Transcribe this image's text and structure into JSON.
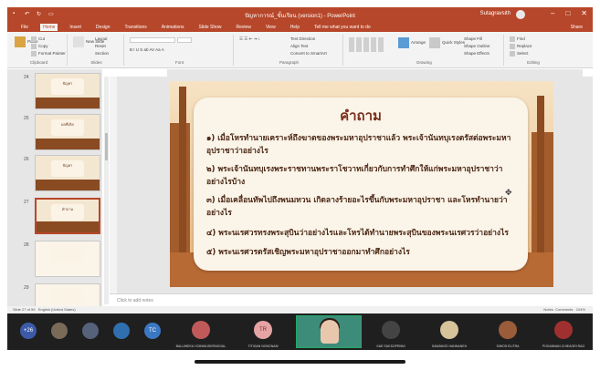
{
  "titlebar": {
    "document_title": "ปัญหาการณ์_ขั้นเรียน (version1) - PowerPoint",
    "user_name": "Sutagravsith",
    "minimize": "–",
    "restore": "□",
    "close": "✕"
  },
  "ribbon_tabs": [
    "File",
    "Home",
    "Insert",
    "Design",
    "Transitions",
    "Animations",
    "Slide Show",
    "Review",
    "View",
    "Help"
  ],
  "tell_me": "Tell me what you want to do",
  "share_label": "Share",
  "ribbon": {
    "clipboard": {
      "paste": "Paste",
      "cut": "Cut",
      "copy": "Copy",
      "format_painter": "Format Painter",
      "label": "Clipboard"
    },
    "slides": {
      "new_slide": "New Slide",
      "layout": "Layout",
      "reset": "Reset",
      "section": "Section",
      "label": "Slides"
    },
    "font": {
      "label": "Font"
    },
    "paragraph": {
      "text_direction": "Text Direction",
      "align_text": "Align Text",
      "convert_smartart": "Convert to SmartArt",
      "label": "Paragraph"
    },
    "drawing": {
      "arrange": "Arrange",
      "quick_styles": "Quick Styles",
      "shape_fill": "Shape Fill",
      "shape_outline": "Shape Outline",
      "shape_effects": "Shape Effects",
      "label": "Drawing"
    },
    "editing": {
      "find": "Find",
      "replace": "Replace",
      "select": "Select",
      "label": "Editing"
    }
  },
  "slides_panel": [
    {
      "number": "24",
      "title": "ปัญหา"
    },
    {
      "number": "25",
      "title": "ผลที่เกิด"
    },
    {
      "number": "26",
      "title": "ปัญหา"
    },
    {
      "number": "27",
      "title": "คำถาม",
      "selected": true
    },
    {
      "number": "28",
      "title": ""
    },
    {
      "number": "29",
      "title": ""
    }
  ],
  "slide": {
    "title": "คำถาม",
    "questions": [
      "๑) เมื่อโหรทำนายเคราะห์ถึงฆาตของพระมหาอุปราชาแล้ว พระเจ้านันทบุเรงตรัสต่อพระมหาอุปราชาว่าอย่างไร",
      "๒) พระเจ้านันทบุเรงพระราชทานพระราโชวาทเกี่ยวกับการทำศึกให้แก่พระมหาอุปราชาว่าอย่างไรบ้าง",
      "๓) เมื่อเคลื่อนทัพไปถึงพนมทวน เกิดลางร้ายอะไรขึ้นกับพระมหาอุปราชา และโหรทำนายว่าอย่างไร",
      "๔) พระนเรศวรทรงพระสุบินว่าอย่างไรและโหรได้ทำนายพระสุบินของพระนเรศวรว่าอย่างไร",
      "๕) พระนเรศวรตรัสเชิญพระมหาอุปราชาออกมาทำศึกอย่างไร"
    ]
  },
  "notes_placeholder": "Click to add notes",
  "status": {
    "slide_count": "Slide 27 of 59",
    "language": "English (United States)",
    "notes": "Notes",
    "comments": "Comments",
    "zoom": "104%"
  },
  "meeting": {
    "more_count": "+26",
    "participants": [
      {
        "name": "BALUWEKU HOINWUSKRNOGAL",
        "color": "#c05a5a"
      },
      {
        "name": "TITIGAN NONGNAM",
        "initials": "TR",
        "color": "#e6a3a3"
      },
      {
        "name": "",
        "color": "#e9c7ad"
      },
      {
        "name": "KAE SUKSOPRNNI",
        "color": "#444444"
      },
      {
        "name": "SAWANGS HANNANEH",
        "color": "#d6c39a"
      },
      {
        "name": "SIWOS ELITRA",
        "color": "#9b5c3a"
      },
      {
        "name": "POGANNAN CHIEAGRI RAG",
        "color": "#a03030"
      }
    ],
    "avatar_initials_tc": "TC"
  },
  "colors": {
    "ppt_red": "#b7472a",
    "slide_card": "#fbf4e8",
    "slide_text": "#4a2614"
  }
}
